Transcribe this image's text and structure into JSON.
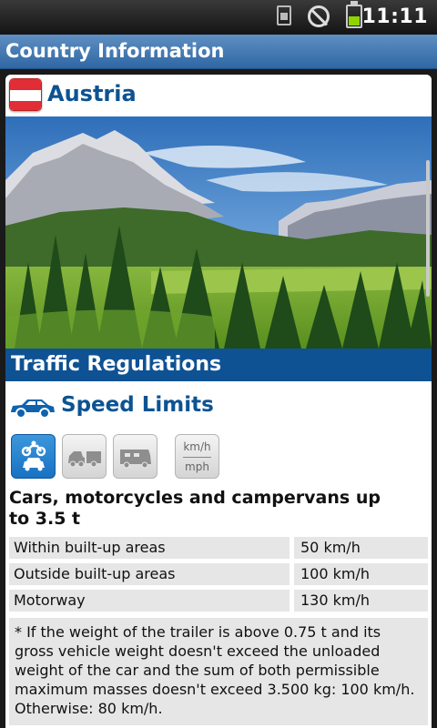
{
  "status_bar": {
    "time": "11:11",
    "icons": [
      "sim-card-icon",
      "do-not-disturb-icon",
      "battery-icon"
    ]
  },
  "app_bar": {
    "title": "Country Information"
  },
  "country": {
    "name": "Austria",
    "flag_icon": "austria-flag-icon",
    "image": "alpine-landscape-image"
  },
  "traffic": {
    "section_label": "Traffic Regulations",
    "speed_limits_label": "Speed Limits",
    "vehicle_tabs": [
      {
        "icon": "car-motorcycle-icon",
        "selected": true
      },
      {
        "icon": "car-trailer-icon",
        "selected": false
      },
      {
        "icon": "campervan-icon",
        "selected": false
      }
    ],
    "unit_toggle": {
      "top": "km/h",
      "bottom": "mph"
    },
    "vehicle_title": "Cars, motorcycles and campervans up to 3.5 t",
    "rows": [
      {
        "label": "Within built-up areas",
        "value": "50 km/h"
      },
      {
        "label": "Outside built-up areas",
        "value": "100 km/h"
      },
      {
        "label": "Motorway",
        "value": "130 km/h"
      }
    ],
    "note": "* If the weight of the trailer is above 0.75 t and its gross vehicle weight doesn't exceed the unloaded weight of the car and the sum of both permissible maximum masses doesn't exceed 3.500 kg: 100 km/h. Otherwise: 80 km/h."
  },
  "colors": {
    "title_bar": "#2f67a4",
    "section_bar": "#0e5294",
    "heading_text": "#0c5392",
    "row_background": "#e6e6e6"
  }
}
